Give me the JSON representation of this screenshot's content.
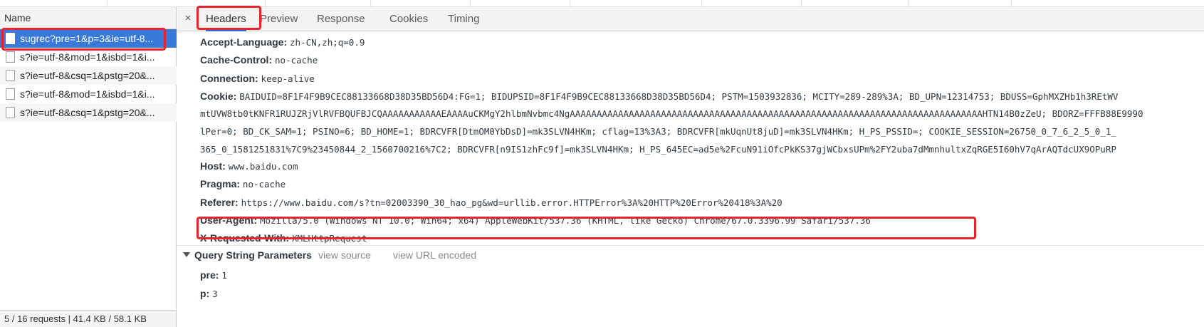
{
  "request_list": {
    "header": "Name",
    "rows": [
      {
        "label": "sugrec?pre=1&p=3&ie=utf-8..."
      },
      {
        "label": "s?ie=utf-8&mod=1&isbd=1&i..."
      },
      {
        "label": "s?ie=utf-8&csq=1&pstg=20&..."
      },
      {
        "label": "s?ie=utf-8&mod=1&isbd=1&i..."
      },
      {
        "label": "s?ie=utf-8&csq=1&pstg=20&..."
      }
    ],
    "status": "5 / 16 requests | 41.4 KB / 58.1 KB"
  },
  "tabs": {
    "close": "×",
    "items": [
      {
        "label": "Headers"
      },
      {
        "label": "Preview"
      },
      {
        "label": "Response"
      },
      {
        "label": "Cookies"
      },
      {
        "label": "Timing"
      }
    ]
  },
  "headers": {
    "accept_language": {
      "key": "Accept-Language:",
      "value": "zh-CN,zh;q=0.9"
    },
    "cache_control": {
      "key": "Cache-Control:",
      "value": "no-cache"
    },
    "connection": {
      "key": "Connection:",
      "value": "keep-alive"
    },
    "cookie": {
      "key": "Cookie:",
      "line1": "BAIDUID=8F1F4F9B9CEC88133668D38D35BD56D4:FG=1; BIDUPSID=8F1F4F9B9CEC88133668D38D35BD56D4; PSTM=1503932836; MCITY=289-289%3A; BD_UPN=12314753; BDUSS=GphMXZHb1h3REtWV",
      "line2": "mtUVW8tb0tKNFR1RUJZRjVlRVFBQUFBJCQAAAAAAAAAAAEAAAAuCKMgY2hlbmNvbmc4NgAAAAAAAAAAAAAAAAAAAAAAAAAAAAAAAAAAAAAAAAAAAAAAAAAAAAAAAAAAAAAAAAAAAAAAAAAAAAAHTN14B0zZeU; BDORZ=FFFB88E9990",
      "line3": "lPer=0; BD_CK_SAM=1; PSINO=6; BD_HOME=1; BDRCVFR[DtmOM0YbDsD]=mk3SLVN4HKm; cflag=13%3A3; BDRCVFR[mkUqnUt8juD]=mk3SLVN4HKm; H_PS_PSSID=; COOKIE_SESSION=26750_0_7_6_2_5_0_1_",
      "line4": "365_0_1581251831%7C9%23450844_2_1560700216%7C2; BDRCVFR[n9IS1zhFc9f]=mk3SLVN4HKm; H_PS_645EC=ad5e%2FcuN91iOfcPkKS37gjWCbxsUPm%2FY2uba7dMmnhultxZqRGE5I60hV7qArAQTdcUX9OPuRP"
    },
    "host": {
      "key": "Host:",
      "value": "www.baidu.com"
    },
    "pragma": {
      "key": "Pragma:",
      "value": "no-cache"
    },
    "referer": {
      "key": "Referer:",
      "value": "https://www.baidu.com/s?tn=02003390_30_hao_pg&wd=urllib.error.HTTPError%3A%20HTTP%20Error%20418%3A%20"
    },
    "user_agent": {
      "key": "User-Agent:",
      "value": "Mozilla/5.0 (Windows NT 10.0; Win64; x64) AppleWebKit/537.36 (KHTML, like Gecko) Chrome/67.0.3396.99 Safari/537.36"
    },
    "x_requested_with": {
      "key": "X-Requested-With:",
      "value": "XMLHttpRequest"
    }
  },
  "query_params": {
    "title": "Query String Parameters",
    "view_source": "view source",
    "view_url_encoded": "view URL encoded",
    "params": [
      {
        "key": "pre:",
        "value": "1"
      },
      {
        "key": "p:",
        "value": "3"
      }
    ]
  },
  "colors": {
    "selected_row": "#3879d9",
    "highlight_box": "#e8232b",
    "active_tab_underline": "#1a73e8"
  }
}
